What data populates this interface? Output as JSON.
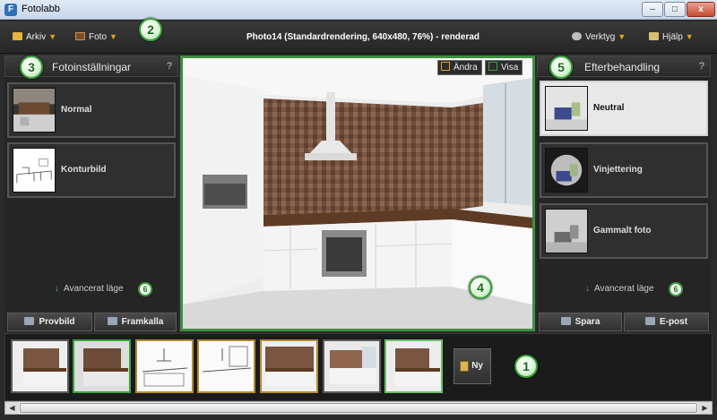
{
  "window": {
    "title": "Fotolabb",
    "buttons": {
      "minimize": "–",
      "maximize": "□",
      "close": "x"
    }
  },
  "toolbar": {
    "menus": [
      {
        "label": "Arkiv",
        "icon": "folder-icon"
      },
      {
        "label": "Foto",
        "icon": "film-icon"
      },
      {
        "label": "Verktyg",
        "icon": "gear-icon"
      },
      {
        "label": "Hjälp",
        "icon": "help-icon"
      }
    ],
    "status_title": "Photo14 (Standardrendering, 640x480, 76%) - renderad"
  },
  "callouts": [
    "1",
    "2",
    "3",
    "4",
    "5",
    "6",
    "6"
  ],
  "left_panel": {
    "title": "Fotoinställningar",
    "help": "?",
    "options": [
      {
        "label": "Normal"
      },
      {
        "label": "Konturbild"
      }
    ],
    "advanced_link": "Avancerat läge",
    "buttons": {
      "preview": "Provbild",
      "develop": "Framkalla"
    }
  },
  "right_panel": {
    "title": "Efterbehandling",
    "help": "?",
    "options": [
      {
        "label": "Neutral"
      },
      {
        "label": "Vinjettering"
      },
      {
        "label": "Gammalt foto"
      }
    ],
    "advanced_link": "Avancerat läge",
    "buttons": {
      "save": "Spara",
      "email": "E-post"
    }
  },
  "preview": {
    "toggle_edit": "Ändra",
    "toggle_view": "Visa"
  },
  "filmstrip": {
    "new_button": "Ny"
  },
  "colors": {
    "accent_green": "#3aa03a",
    "accent_gold": "#e6a417"
  }
}
